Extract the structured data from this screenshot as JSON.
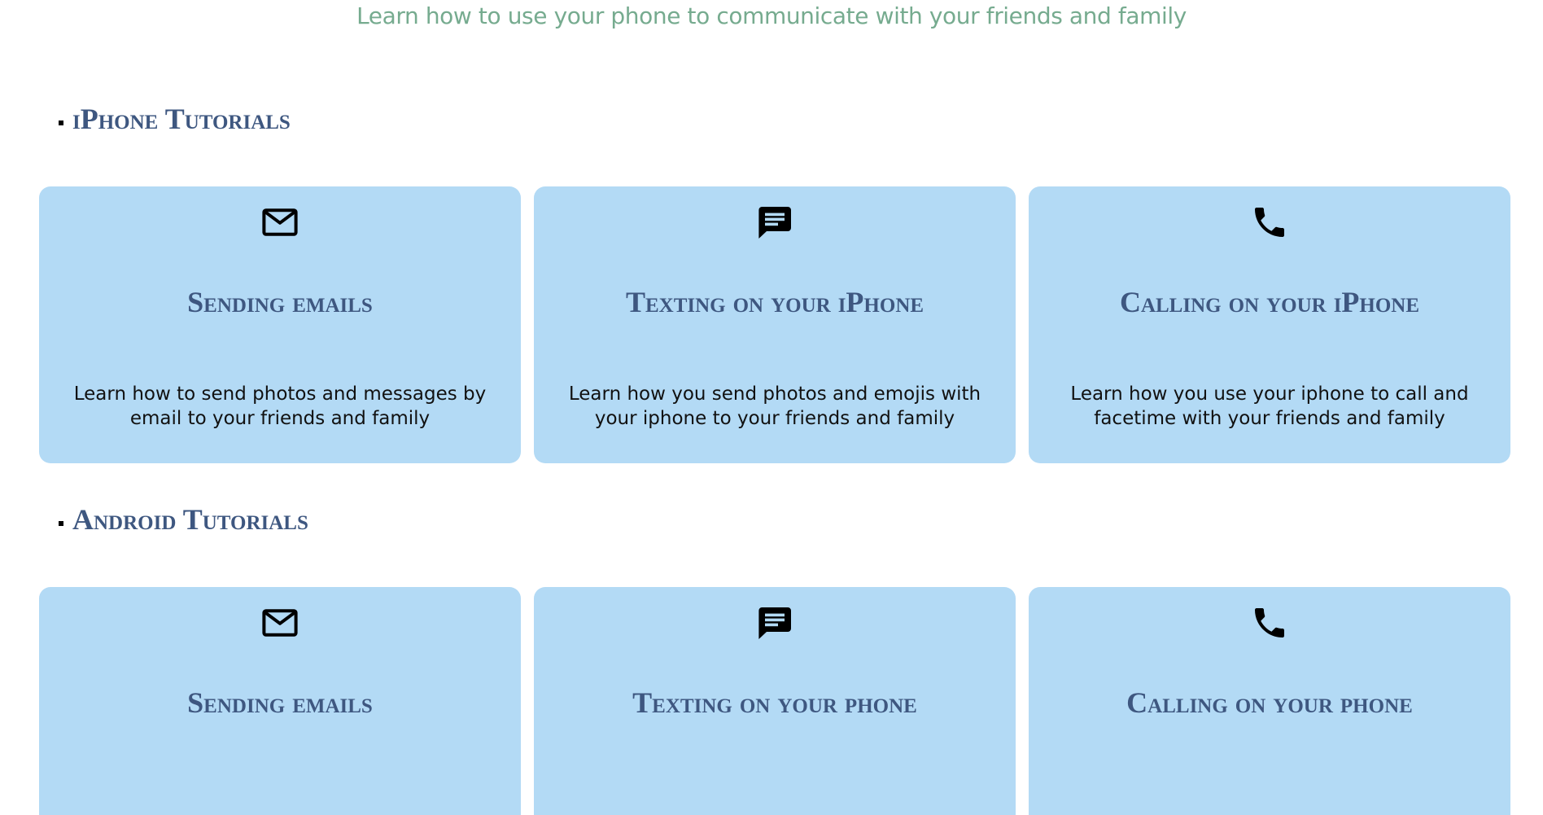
{
  "header": {
    "subtitle": "Learn how to use your phone to communicate with your friends and family"
  },
  "sections": [
    {
      "heading": "iPhone Tutorials",
      "cards": [
        {
          "icon": "mail-icon",
          "title": "Sending emails",
          "description": "Learn how to send photos and messages by email to your friends and family"
        },
        {
          "icon": "chat-message-icon",
          "title": "Texting on your iPhone",
          "description": "Learn how you send photos and emojis with your iphone to your friends and family"
        },
        {
          "icon": "phone-icon",
          "title": "Calling on your iPhone",
          "description": "Learn how you use your iphone to call and facetime with your friends and family"
        }
      ]
    },
    {
      "heading": "Android Tutorials",
      "cards": [
        {
          "icon": "mail-icon",
          "title": "Sending emails"
        },
        {
          "icon": "chat-message-icon",
          "title": "Texting on your phone"
        },
        {
          "icon": "phone-icon",
          "title": "Calling on your phone"
        }
      ]
    }
  ],
  "colors": {
    "subtitle": "#76ab8f",
    "heading": "#3e5780",
    "card_background": "#b3daf5",
    "text": "#111111"
  }
}
